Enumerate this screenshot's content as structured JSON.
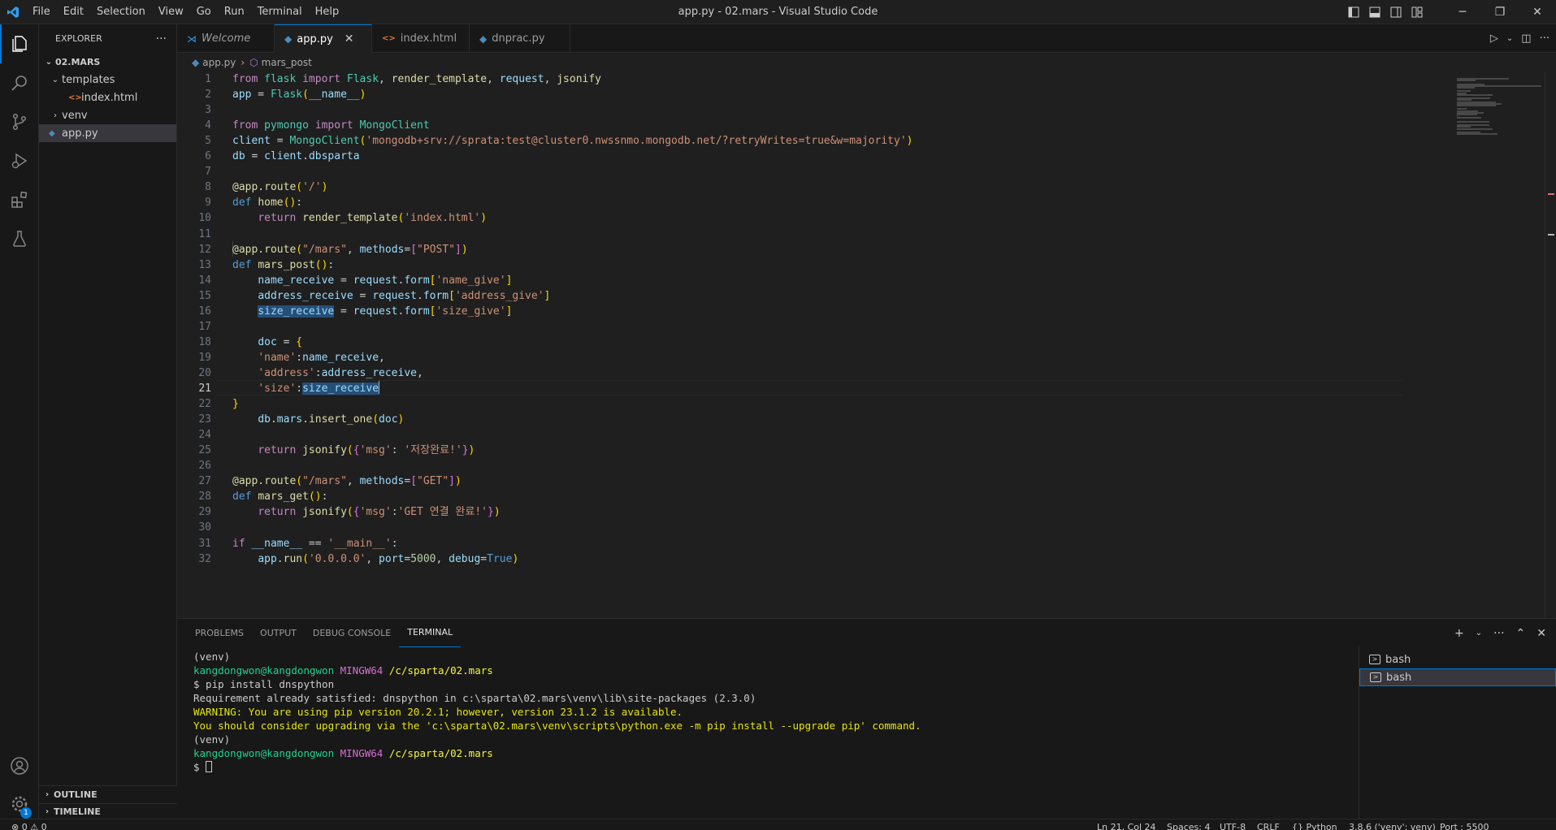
{
  "window": {
    "title": "app.py - 02.mars - Visual Studio Code"
  },
  "menu": [
    "File",
    "Edit",
    "Selection",
    "View",
    "Go",
    "Run",
    "Terminal",
    "Help"
  ],
  "sidebar": {
    "title": "EXPLORER",
    "more": "···",
    "root": "02.MARS",
    "items": [
      {
        "label": "templates",
        "type": "folder-open"
      },
      {
        "label": "index.html",
        "type": "html"
      },
      {
        "label": "venv",
        "type": "folder"
      },
      {
        "label": "app.py",
        "type": "python"
      }
    ],
    "outline": "OUTLINE",
    "timeline": "TIMELINE"
  },
  "tabs": [
    {
      "label": "Welcome",
      "icon": "vscode-icon"
    },
    {
      "label": "app.py",
      "icon": "python-icon"
    },
    {
      "label": "index.html",
      "icon": "html-icon"
    },
    {
      "label": "dnprac.py",
      "icon": "python-icon"
    }
  ],
  "tab_close": "✕",
  "breadcrumb": {
    "file": "app.py",
    "symbol": "mars_post"
  },
  "editor": {
    "line_numbers": [
      "1",
      "2",
      "3",
      "4",
      "5",
      "6",
      "7",
      "8",
      "9",
      "10",
      "11",
      "12",
      "13",
      "14",
      "15",
      "16",
      "17",
      "18",
      "19",
      "20",
      "21",
      "22",
      "23",
      "24",
      "25",
      "26",
      "27",
      "28",
      "29",
      "30",
      "31",
      "32"
    ]
  },
  "panel": {
    "tabs": [
      "PROBLEMS",
      "OUTPUT",
      "DEBUG CONSOLE",
      "TERMINAL"
    ],
    "terminal_lines": {
      "l1": "(venv)",
      "l2_user": "kangdongwon@kangdongwon",
      "l2_host": "MINGW64",
      "l2_path": "/c/sparta/02.mars",
      "l3": "$ pip install dnspython",
      "l4": "Requirement already satisfied: dnspython in c:\\sparta\\02.mars\\venv\\lib\\site-packages (2.3.0)",
      "l5": "WARNING: You are using pip version 20.2.1; however, version 23.1.2 is available.",
      "l6": "You should consider upgrading via the 'c:\\sparta\\02.mars\\venv\\scripts\\python.exe -m pip install --upgrade pip' command.",
      "l7": "(venv)",
      "l8_user": "kangdongwon@kangdongwon",
      "l8_host": "MINGW64",
      "l8_path": "/c/sparta/02.mars",
      "l9": "$ "
    },
    "terminals": [
      "bash",
      "bash"
    ]
  },
  "statusbar": {
    "problems": "⊗ 0  ⚠ 0",
    "position": "Ln 21, Col 24",
    "spaces": "Spaces: 4",
    "encoding": "UTF-8",
    "eol": "CRLF",
    "language": "{} Python",
    "interpreter": "3.8.6 ('venv': venv)",
    "port": "Port : 5500"
  },
  "notifications_badge": "1",
  "colors": {
    "accent": "#0078d4",
    "editor_bg": "#1f1f1f",
    "sidebar_bg": "#181818"
  }
}
